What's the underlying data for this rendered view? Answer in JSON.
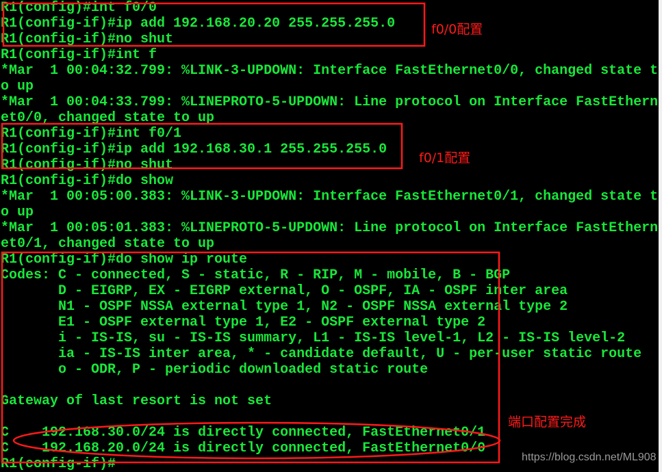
{
  "terminal": {
    "text_color": "#18e83a",
    "background": "#000000",
    "lines": [
      "R1(config)#int f0/0",
      "R1(config-if)#ip add 192.168.20.20 255.255.255.0",
      "R1(config-if)#no shut",
      "R1(config-if)#int f",
      "*Mar  1 00:04:32.799: %LINK-3-UPDOWN: Interface FastEthernet0/0, changed state t",
      "o up",
      "*Mar  1 00:04:33.799: %LINEPROTO-5-UPDOWN: Line protocol on Interface FastEthern",
      "et0/0, changed state to up",
      "R1(config-if)#int f0/1",
      "R1(config-if)#ip add 192.168.30.1 255.255.255.0",
      "R1(config-if)#no shut",
      "R1(config-if)#do show",
      "*Mar  1 00:05:00.383: %LINK-3-UPDOWN: Interface FastEthernet0/1, changed state t",
      "o up",
      "*Mar  1 00:05:01.383: %LINEPROTO-5-UPDOWN: Line protocol on Interface FastEthern",
      "et0/1, changed state to up",
      "R1(config-if)#do show ip route",
      "Codes: C - connected, S - static, R - RIP, M - mobile, B - BGP",
      "       D - EIGRP, EX - EIGRP external, O - OSPF, IA - OSPF inter area",
      "       N1 - OSPF NSSA external type 1, N2 - OSPF NSSA external type 2",
      "       E1 - OSPF external type 1, E2 - OSPF external type 2",
      "       i - IS-IS, su - IS-IS summary, L1 - IS-IS level-1, L2 - IS-IS level-2",
      "       ia - IS-IS inter area, * - candidate default, U - per-user static route",
      "       o - ODR, P - periodic downloaded static route",
      "",
      "Gateway of last resort is not set",
      "",
      "C    192.168.30.0/24 is directly connected, FastEthernet0/1",
      "C    192.168.20.0/24 is directly connected, FastEthernet0/0",
      "R1(config-if)#"
    ]
  },
  "annotations": {
    "color": "#ff1a1a",
    "f00_label": "f0/0配置",
    "f01_label": "f0/1配置",
    "done_label": "端口配置完成"
  },
  "watermark": "https://blog.csdn.net/ML908"
}
